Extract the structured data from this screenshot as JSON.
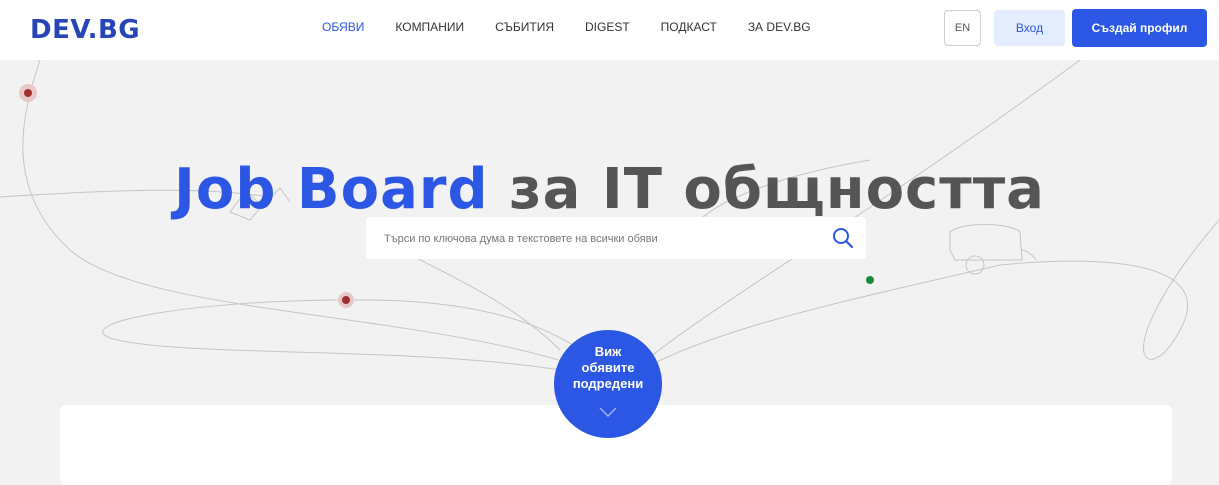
{
  "header": {
    "logo": "DEV.BG",
    "nav": [
      {
        "label": "ОБЯВИ",
        "active": true
      },
      {
        "label": "КОМПАНИИ",
        "active": false
      },
      {
        "label": "СЪБИТИЯ",
        "active": false
      },
      {
        "label": "DIGEST",
        "active": false
      },
      {
        "label": "ПОДКАСТ",
        "active": false
      },
      {
        "label": "ЗА DEV.BG",
        "active": false
      }
    ],
    "lang_label": "EN",
    "login_label": "Вход",
    "signup_label": "Създай профил"
  },
  "hero": {
    "title_highlight": "Job Board",
    "title_rest": " за IT общността",
    "search": {
      "placeholder": "Търси по ключова дума в текстовете на всички обяви",
      "value": ""
    },
    "cta_label": "Виж\nобявите\nподредени"
  },
  "colors": {
    "brand": "#2b57e4",
    "logo": "#2845b8",
    "background": "#f2f2f2"
  },
  "icons": [
    "search-icon",
    "chevron-down-icon"
  ]
}
